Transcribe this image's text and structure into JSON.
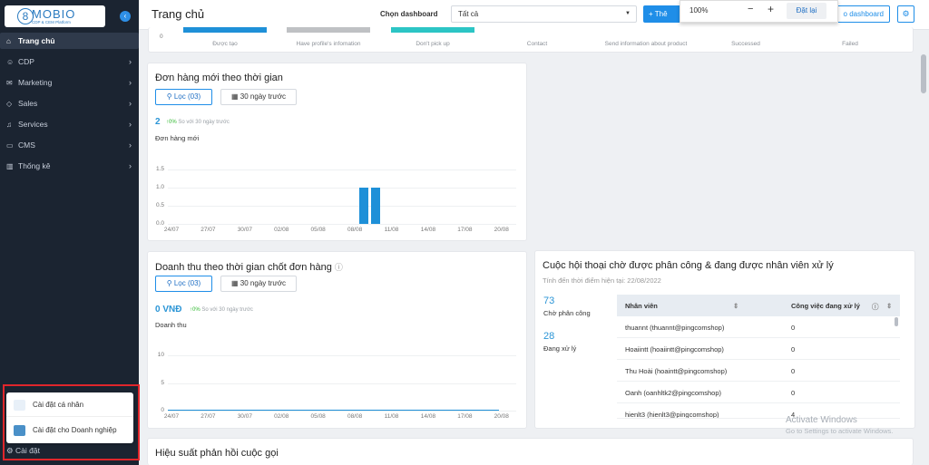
{
  "sidebar": {
    "logo_mark": "8",
    "logo_name": "MOBIO",
    "logo_sub": "CDP & CEM Platform",
    "collapse_icon": "‹",
    "items": [
      {
        "label": "Trang chủ",
        "icon": "home-icon"
      },
      {
        "label": "CDP",
        "icon": "user-group-icon"
      },
      {
        "label": "Marketing",
        "icon": "megaphone-icon"
      },
      {
        "label": "Sales",
        "icon": "tag-icon"
      },
      {
        "label": "Services",
        "icon": "headset-icon"
      },
      {
        "label": "CMS",
        "icon": "monitor-icon"
      },
      {
        "label": "Thống kê",
        "icon": "chart-icon"
      }
    ],
    "settings_label": "Cài đặt",
    "popup": [
      {
        "label": "Cài đặt cá nhân"
      },
      {
        "label": "Cài đặt cho Doanh nghiệp"
      }
    ]
  },
  "topbar": {
    "title": "Trang chủ",
    "dashboard_label": "Chọn dashboard",
    "dashboard_value": "Tất cả",
    "add_button": "+ Thê",
    "dashboard_button": "o dashboard"
  },
  "zoom": {
    "value": "100%",
    "minus": "−",
    "plus": "+",
    "reset": "Đặt lại"
  },
  "funnel": {
    "axis_zero": "0",
    "steps": [
      {
        "label": "Được tạo",
        "color": "#1e90d8"
      },
      {
        "label": "Have profile's infomation",
        "color": "#bfc1c4"
      },
      {
        "label": "Don't pick up",
        "color": "#2cc5c5"
      },
      {
        "label": "Contact",
        "color": ""
      },
      {
        "label": "Send information about product",
        "color": ""
      },
      {
        "label": "Successed",
        "color": ""
      },
      {
        "label": "Failed",
        "color": ""
      }
    ]
  },
  "orders": {
    "title": "Đơn hàng mới theo thời gian",
    "filter": "Lọc (03)",
    "date": "30 ngày trước",
    "value": "2",
    "trend": "↑0%",
    "trend_note": "So với 30 ngày trước",
    "metric": "Đơn hàng mới"
  },
  "revenue": {
    "title": "Doanh thu theo thời gian chốt đơn hàng",
    "help_icon": "ⓘ",
    "filter": "Lọc (03)",
    "date": "30 ngày trước",
    "value": "0 VNĐ",
    "trend": "↑0%",
    "trend_note": "So với 30 ngày trước",
    "metric": "Doanh thu"
  },
  "chart_data": [
    {
      "type": "bar",
      "x": [
        "24/07",
        "27/07",
        "30/07",
        "02/08",
        "05/08",
        "08/08",
        "11/08",
        "14/08",
        "17/08",
        "20/08"
      ],
      "bars": [
        {
          "x": "09/08",
          "value": 1
        },
        {
          "x": "10/08",
          "value": 1
        }
      ],
      "yticks": [
        "1.5",
        "1.0",
        "0.5",
        "0.0"
      ],
      "ylim": [
        0,
        1.5
      ],
      "color": "#1e90d8"
    },
    {
      "type": "line",
      "x": [
        "24/07",
        "27/07",
        "30/07",
        "02/08",
        "05/08",
        "08/08",
        "11/08",
        "14/08",
        "17/08",
        "20/08"
      ],
      "yticks": [
        "10",
        "5",
        "0"
      ],
      "ylim": [
        0,
        10
      ],
      "values": [
        0,
        0,
        0,
        0,
        0,
        0,
        0,
        0,
        0,
        0
      ],
      "color": "#1e90d8"
    }
  ],
  "conversations": {
    "title": "Cuộc hội thoại chờ được phân công & đang được nhân viên xử lý",
    "subtitle": "Tính đến thời điểm hiện tại: 22/08/2022",
    "waiting_value": "73",
    "waiting_label": "Chờ phân công",
    "processing_value": "28",
    "processing_label": "Đang xử lý",
    "col_staff": "Nhân viên",
    "col_sort": "⇕",
    "col_work": "Công việc đang xử lý",
    "col_help": "ⓘ",
    "rows": [
      {
        "name": "thuannt (thuannt@pingcomshop)",
        "count": "0"
      },
      {
        "name": "Hoaiintt (hoaiintt@pingcomshop)",
        "count": "0"
      },
      {
        "name": "Thu Hoài (hoaintt@pingcomshop)",
        "count": "0"
      },
      {
        "name": "Oanh (oanhltk2@pingcomshop)",
        "count": "0"
      },
      {
        "name": "hienlt3 (hienlt3@pingcomshop)",
        "count": "4"
      }
    ]
  },
  "response": {
    "title": "Hiệu suất phản hồi cuộc gọi"
  },
  "watermark": {
    "line1": "Activate Windows",
    "line2": "Go to Settings to activate Windows."
  }
}
